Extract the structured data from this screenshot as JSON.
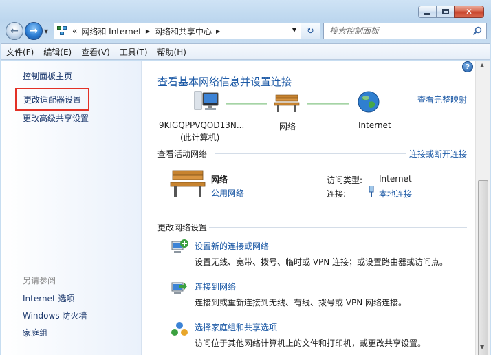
{
  "window": {
    "close_glyph": "✕"
  },
  "address_bar": {
    "overflow_glyph": "«",
    "breadcrumbs": [
      "网络和 Internet",
      "网络和共享中心"
    ],
    "separator_glyph": "▶",
    "dropdown_glyph": "▼",
    "refresh_glyph": "↻"
  },
  "search": {
    "placeholder": "搜索控制面板"
  },
  "menu": {
    "items": [
      "文件(F)",
      "编辑(E)",
      "查看(V)",
      "工具(T)",
      "帮助(H)"
    ]
  },
  "left_pane": {
    "home": "控制面板主页",
    "change_adapter": "更改适配器设置",
    "change_advanced": "更改高级共享设置",
    "see_also_title": "另请参阅",
    "see_also": [
      "Internet 选项",
      "Windows 防火墙",
      "家庭组"
    ]
  },
  "main": {
    "help_glyph": "?",
    "title": "查看基本网络信息并设置连接",
    "full_map_link": "查看完整映射",
    "map_nodes": {
      "computer_line1": "9KIGQPPVQOD13N...",
      "computer_line2": "(此计算机)",
      "network": "网络",
      "internet": "Internet"
    },
    "active_networks": {
      "heading": "查看活动网络",
      "connect_link": "连接或断开连接",
      "name": "网络",
      "type": "公用网络",
      "access_type_key": "访问类型:",
      "access_type_value": "Internet",
      "connection_key": "连接:",
      "connection_value": "本地连接"
    },
    "change_settings": {
      "heading": "更改网络设置",
      "tasks": [
        {
          "link": "设置新的连接或网络",
          "desc": "设置无线、宽带、拨号、临时或 VPN 连接；或设置路由器或访问点。"
        },
        {
          "link": "连接到网络",
          "desc": "连接到或重新连接到无线、有线、拨号或 VPN 网络连接。"
        },
        {
          "link": "选择家庭组和共享选项",
          "desc": "访问位于其他网络计算机上的文件和打印机，或更改共享设置。"
        }
      ]
    }
  },
  "colors": {
    "link": "#1d5aa6",
    "highlight_border": "#e33126",
    "title": "#1d5aa6"
  }
}
